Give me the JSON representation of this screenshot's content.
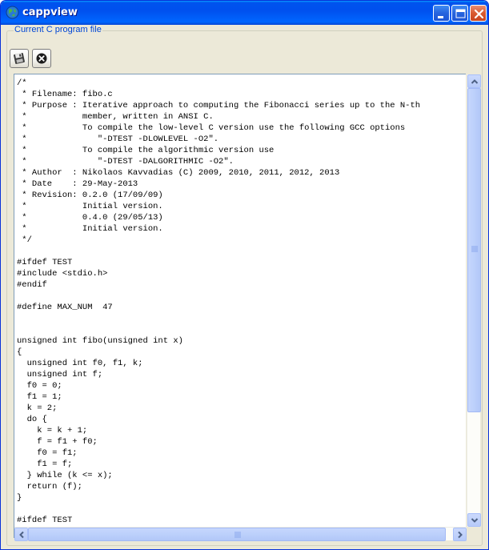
{
  "window": {
    "title": "cappview"
  },
  "groupbox": {
    "label": "Current C program file"
  },
  "toolbar": {
    "save_icon": "floppy-disk-icon",
    "close_icon": "close-circle-icon"
  },
  "editor": {
    "lines": [
      "/*",
      " * Filename: fibo.c",
      " * Purpose : Iterative approach to computing the Fibonacci series up to the N-th",
      " *           member, written in ANSI C.",
      " *           To compile the low-level C version use the following GCC options",
      " *              \"-DTEST -DLOWLEVEL -O2\".",
      " *           To compile the algorithmic version use",
      " *              \"-DTEST -DALGORITHMIC -O2\".",
      " * Author  : Nikolaos Kavvadias (C) 2009, 2010, 2011, 2012, 2013",
      " * Date    : 29-May-2013",
      " * Revision: 0.2.0 (17/09/09)",
      " *           Initial version.",
      " *           0.4.0 (29/05/13)",
      " *           Initial version.",
      " */",
      "",
      "#ifdef TEST",
      "#include <stdio.h>",
      "#endif",
      "",
      "#define MAX_NUM  47",
      "",
      "",
      "unsigned int fibo(unsigned int x)",
      "{",
      "  unsigned int f0, f1, k;",
      "  unsigned int f;",
      "  f0 = 0;",
      "  f1 = 1;",
      "  k = 2;",
      "  do {",
      "    k = k + 1;",
      "    f = f1 + f0;",
      "    f0 = f1;",
      "    f1 = f;",
      "  } while (k <= x);",
      "  return (f);",
      "}",
      "",
      "#ifdef TEST"
    ]
  },
  "scrollbars": {
    "vertical_position": 0,
    "horizontal_position": 0
  },
  "colors": {
    "titlebar": "#0054e3",
    "group_label": "#0046d5",
    "editor_border": "#7f9db9",
    "scroll_thumb": "#c1d3fb"
  }
}
